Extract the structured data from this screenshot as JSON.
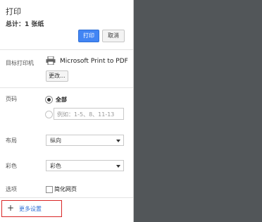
{
  "header": {
    "title": "打印",
    "summary": "总计：1 张纸",
    "print_button": "打印",
    "cancel_button": "取消"
  },
  "destination": {
    "label": "目标打印机",
    "printer_icon": "printer-icon",
    "printer_name": "Microsoft Print to PDF",
    "change_button": "更改..."
  },
  "pages": {
    "label": "页码",
    "options": [
      {
        "label": "全部",
        "checked": true
      },
      {
        "label": "",
        "checked": false
      }
    ],
    "input_placeholder": "例如：1-5、8、11-13"
  },
  "layout": {
    "label": "布局",
    "selected": "纵向"
  },
  "color": {
    "label": "彩色",
    "selected": "彩色"
  },
  "options": {
    "label": "选项",
    "simplify_label": "简化网页",
    "simplify_checked": false
  },
  "more_settings": {
    "label": "更多设置",
    "icon": "plus-icon"
  },
  "colors": {
    "accent": "#4285f4",
    "preview_bg": "#525659",
    "highlight_border": "#d92727"
  }
}
